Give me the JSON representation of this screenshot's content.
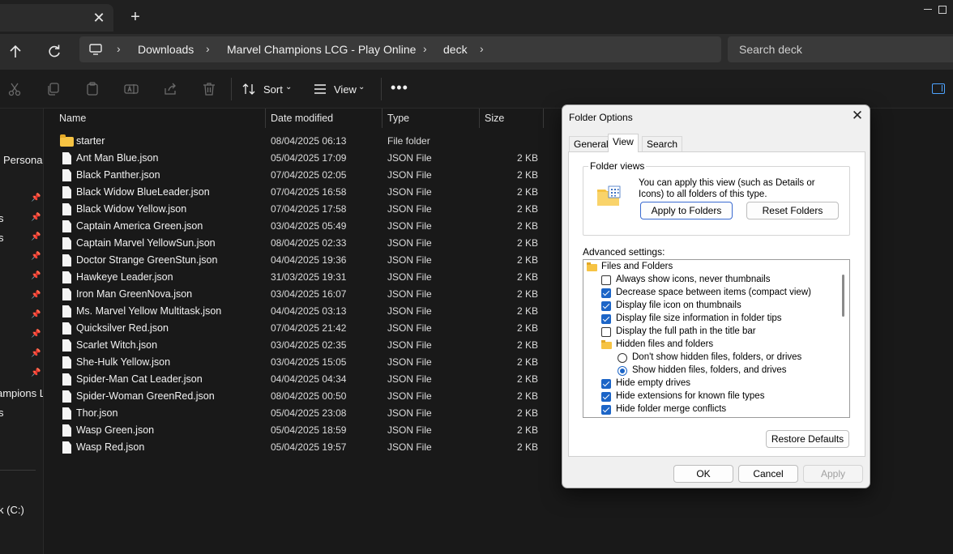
{
  "tabbar": {
    "close_glyph": "✕",
    "add_glyph": "+"
  },
  "nav": {
    "breadcrumbs": [
      "Downloads",
      "Marvel Champions LCG - Play Online",
      "deck"
    ],
    "search_placeholder": "Search deck"
  },
  "commands": {
    "sort_label": "Sort",
    "view_label": "View",
    "more_label": "•••"
  },
  "sidebar": {
    "labels": [
      "Personal",
      "s",
      "s",
      "ampions L",
      "s",
      "k (C:)"
    ]
  },
  "columns": {
    "name": "Name",
    "date": "Date modified",
    "type": "Type",
    "size": "Size"
  },
  "files": [
    {
      "name": "starter",
      "date": "08/04/2025 06:13",
      "type": "File folder",
      "size": "",
      "kind": "folder"
    },
    {
      "name": "Ant Man Blue.json",
      "date": "05/04/2025 17:09",
      "type": "JSON File",
      "size": "2 KB",
      "kind": "file"
    },
    {
      "name": "Black Panther.json",
      "date": "07/04/2025 02:05",
      "type": "JSON File",
      "size": "2 KB",
      "kind": "file"
    },
    {
      "name": "Black Widow BlueLeader.json",
      "date": "07/04/2025 16:58",
      "type": "JSON File",
      "size": "2 KB",
      "kind": "file"
    },
    {
      "name": "Black Widow Yellow.json",
      "date": "07/04/2025 17:58",
      "type": "JSON File",
      "size": "2 KB",
      "kind": "file"
    },
    {
      "name": "Captain America Green.json",
      "date": "03/04/2025 05:49",
      "type": "JSON File",
      "size": "2 KB",
      "kind": "file"
    },
    {
      "name": "Captain Marvel YellowSun.json",
      "date": "08/04/2025 02:33",
      "type": "JSON File",
      "size": "2 KB",
      "kind": "file"
    },
    {
      "name": "Doctor Strange GreenStun.json",
      "date": "04/04/2025 19:36",
      "type": "JSON File",
      "size": "2 KB",
      "kind": "file"
    },
    {
      "name": "Hawkeye Leader.json",
      "date": "31/03/2025 19:31",
      "type": "JSON File",
      "size": "2 KB",
      "kind": "file"
    },
    {
      "name": "Iron Man GreenNova.json",
      "date": "03/04/2025 16:07",
      "type": "JSON File",
      "size": "2 KB",
      "kind": "file"
    },
    {
      "name": "Ms. Marvel Yellow Multitask.json",
      "date": "04/04/2025 03:13",
      "type": "JSON File",
      "size": "2 KB",
      "kind": "file"
    },
    {
      "name": "Quicksilver Red.json",
      "date": "07/04/2025 21:42",
      "type": "JSON File",
      "size": "2 KB",
      "kind": "file"
    },
    {
      "name": "Scarlet Witch.json",
      "date": "03/04/2025 02:35",
      "type": "JSON File",
      "size": "2 KB",
      "kind": "file"
    },
    {
      "name": "She-Hulk Yellow.json",
      "date": "03/04/2025 15:05",
      "type": "JSON File",
      "size": "2 KB",
      "kind": "file"
    },
    {
      "name": "Spider-Man Cat Leader.json",
      "date": "04/04/2025 04:34",
      "type": "JSON File",
      "size": "2 KB",
      "kind": "file"
    },
    {
      "name": "Spider-Woman GreenRed.json",
      "date": "08/04/2025 00:50",
      "type": "JSON File",
      "size": "2 KB",
      "kind": "file"
    },
    {
      "name": "Thor.json",
      "date": "05/04/2025 23:08",
      "type": "JSON File",
      "size": "2 KB",
      "kind": "file"
    },
    {
      "name": "Wasp Green.json",
      "date": "05/04/2025 18:59",
      "type": "JSON File",
      "size": "2 KB",
      "kind": "file"
    },
    {
      "name": "Wasp Red.json",
      "date": "05/04/2025 19:57",
      "type": "JSON File",
      "size": "2 KB",
      "kind": "file"
    }
  ],
  "dialog": {
    "title": "Folder Options",
    "tabs": [
      "General",
      "View",
      "Search"
    ],
    "active_tab": "View",
    "folder_views": {
      "label": "Folder views",
      "description": "You can apply this view (such as Details or Icons) to all folders of this type.",
      "apply_button": "Apply to Folders",
      "reset_button": "Reset Folders"
    },
    "advanced_label": "Advanced settings:",
    "settings": [
      {
        "kind": "folder",
        "label": "Files and Folders",
        "checked": false
      },
      {
        "kind": "checkbox",
        "label": "Always show icons, never thumbnails",
        "checked": false
      },
      {
        "kind": "checkbox",
        "label": "Decrease space between items (compact view)",
        "checked": true
      },
      {
        "kind": "checkbox",
        "label": "Display file icon on thumbnails",
        "checked": true
      },
      {
        "kind": "checkbox",
        "label": "Display file size information in folder tips",
        "checked": true
      },
      {
        "kind": "checkbox",
        "label": "Display the full path in the title bar",
        "checked": false
      },
      {
        "kind": "subfolder",
        "label": "Hidden files and folders",
        "checked": false
      },
      {
        "kind": "radio",
        "label": "Don't show hidden files, folders, or drives",
        "checked": false
      },
      {
        "kind": "radio",
        "label": "Show hidden files, folders, and drives",
        "checked": true
      },
      {
        "kind": "checkbox",
        "label": "Hide empty drives",
        "checked": true
      },
      {
        "kind": "checkbox",
        "label": "Hide extensions for known file types",
        "checked": true
      },
      {
        "kind": "checkbox",
        "label": "Hide folder merge conflicts",
        "checked": true
      }
    ],
    "restore_button": "Restore Defaults",
    "ok_button": "OK",
    "cancel_button": "Cancel",
    "apply_button": "Apply"
  }
}
